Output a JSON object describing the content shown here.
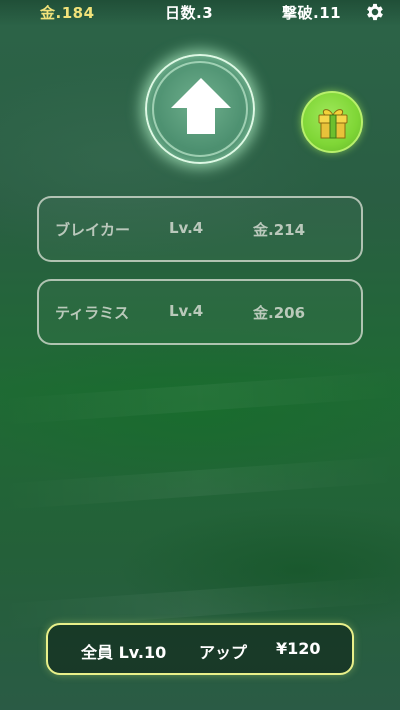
{
  "top_bar": {
    "gold": "金.184",
    "days": "日数.3",
    "kills": "撃破.11",
    "settings_icon": "gear-icon"
  },
  "upgrade_button": {
    "icon": "up-arrow-icon"
  },
  "gift_button": {
    "icon": "gift-box-icon",
    "color": "#7fd636"
  },
  "characters": [
    {
      "name": "ブレイカー",
      "level": "Lv.4",
      "cost": "金.214"
    },
    {
      "name": "ティラミス",
      "level": "Lv.4",
      "cost": "金.206"
    }
  ],
  "bulk_upgrade": {
    "prefix": "全員 Lv.10",
    "action": "アップ",
    "price": "¥120"
  },
  "colors": {
    "gold_text": "#f1e27a",
    "background": "#2a5e43",
    "button_border": "#e9f08a"
  }
}
